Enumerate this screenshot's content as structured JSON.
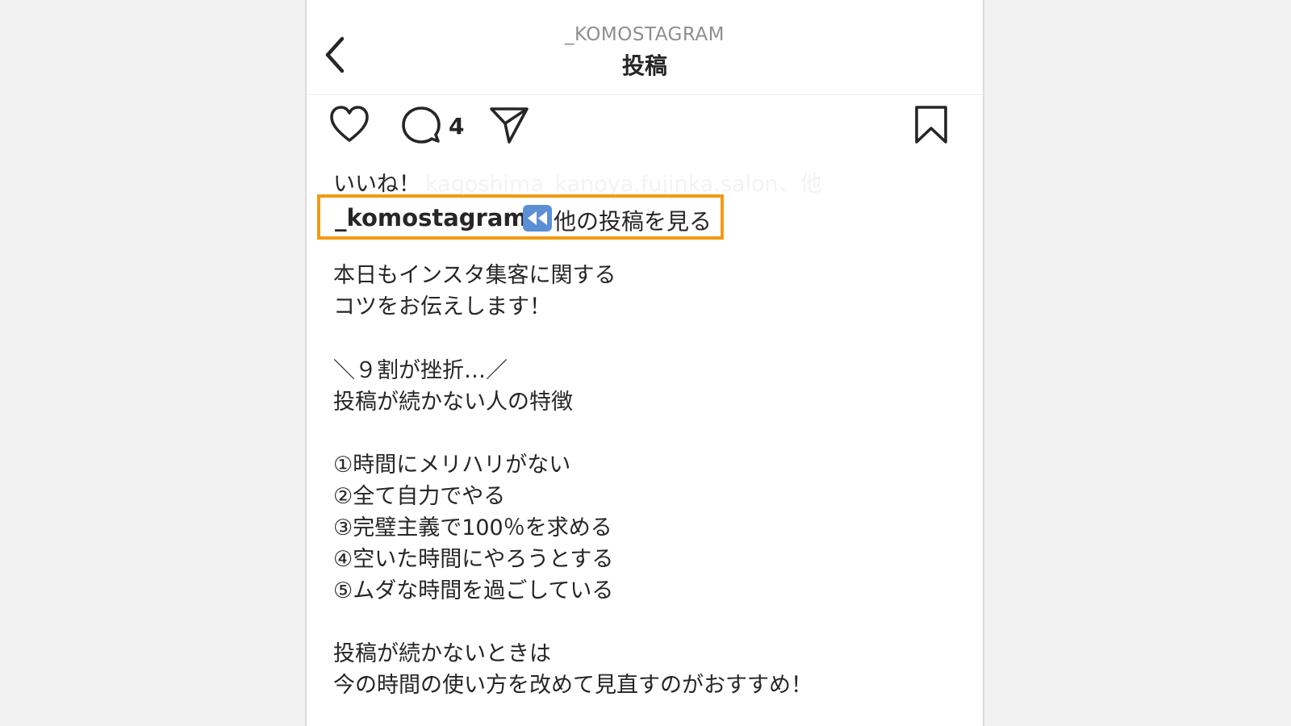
{
  "header": {
    "username": "_KOMOSTAGRAM",
    "title": "投稿"
  },
  "actions": {
    "comment_count": "4"
  },
  "likes": {
    "prefix": "いいね！",
    "names": "kagoshima_kanoya.fujinka.salon、他"
  },
  "caption": {
    "username": "_komostagram",
    "see_more": "他の投稿を見る",
    "lines": [
      "本日もインスタ集客に関する",
      "コツをお伝えします！",
      "",
      "＼９割が挫折…／",
      "投稿が続かない人の特徴",
      "",
      "①時間にメリハリがない",
      "②全て自力でやる",
      "③完璧主義で100％を求める",
      "④空いた時間にやろうとする",
      "⑤ムダな時間を過ごしている",
      "",
      "投稿が続かないときは",
      "今の時間の使い方を改めて見直すのがおすすめ！"
    ]
  },
  "colors": {
    "highlight_border": "#f39a12",
    "rewind_icon": "#5b8fd4"
  },
  "icons": [
    "chevron-left-icon",
    "heart-icon",
    "comment-icon",
    "share-icon",
    "bookmark-icon",
    "rewind-icon"
  ]
}
